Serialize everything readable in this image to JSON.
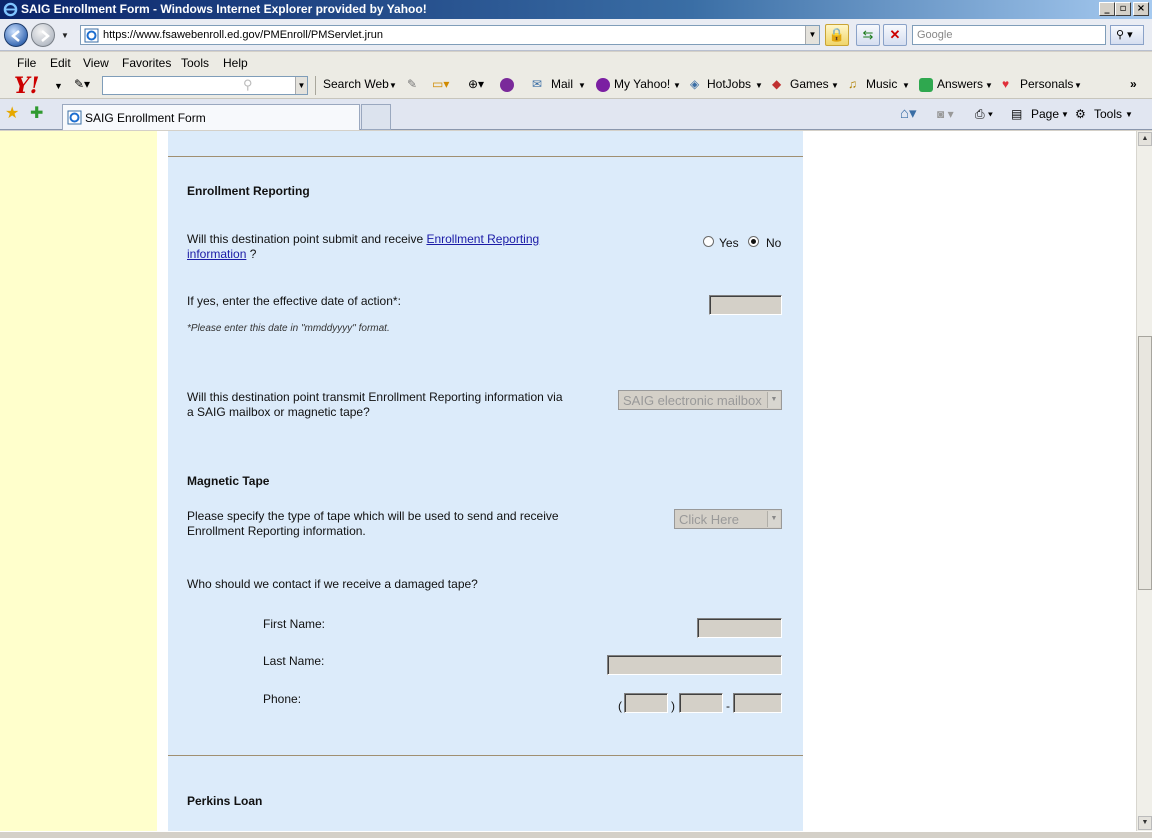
{
  "window": {
    "title": "SAIG Enrollment Form - Windows Internet Explorer provided by Yahoo!"
  },
  "address": {
    "url": "https://www.fsawebenroll.ed.gov/PMEnroll/PMServlet.jrun",
    "search_placeholder": "Google"
  },
  "menu": {
    "file": "File",
    "edit": "Edit",
    "view": "View",
    "favorites": "Favorites",
    "tools": "Tools",
    "help": "Help"
  },
  "yahoo_toolbar": {
    "search_web": "Search Web",
    "mail": "Mail",
    "my_yahoo": "My Yahoo!",
    "hotjobs": "HotJobs",
    "games": "Games",
    "music": "Music",
    "answers": "Answers",
    "personals": "Personals"
  },
  "tabs": {
    "active_tab": "SAIG Enrollment Form",
    "page_label": "Page",
    "tools_label": "Tools"
  },
  "form": {
    "enrollment_heading": "Enrollment Reporting",
    "q1_text": "Will this destination point submit and receive ",
    "q1_link_line1": "Enrollment Reporting",
    "q1_link_line2": "information",
    "q1_suffix": " ?",
    "yes_label": "Yes",
    "no_label": "No",
    "selected": "No",
    "date_label": "If yes, enter the effective date of action*:",
    "date_note": "*Please enter this date in \"mmddyyyy\" format.",
    "transmit_line1": "Will this destination point transmit Enrollment Reporting information via",
    "transmit_line2": "a SAIG mailbox or magnetic tape?",
    "transmit_value": "SAIG electronic mailbox",
    "tape_heading": "Magnetic Tape",
    "tape_line1": "Please specify the type of tape which will be used to send and receive",
    "tape_line2": "Enrollment Reporting information.",
    "tape_value": "Click Here",
    "contact_question": "Who should we contact if we receive a damaged tape?",
    "first_name_label": "First Name:",
    "last_name_label": "Last Name:",
    "phone_label": "Phone:",
    "phone_open": "(",
    "phone_close": ")",
    "phone_dash": "-",
    "perkins_heading": "Perkins Loan"
  }
}
